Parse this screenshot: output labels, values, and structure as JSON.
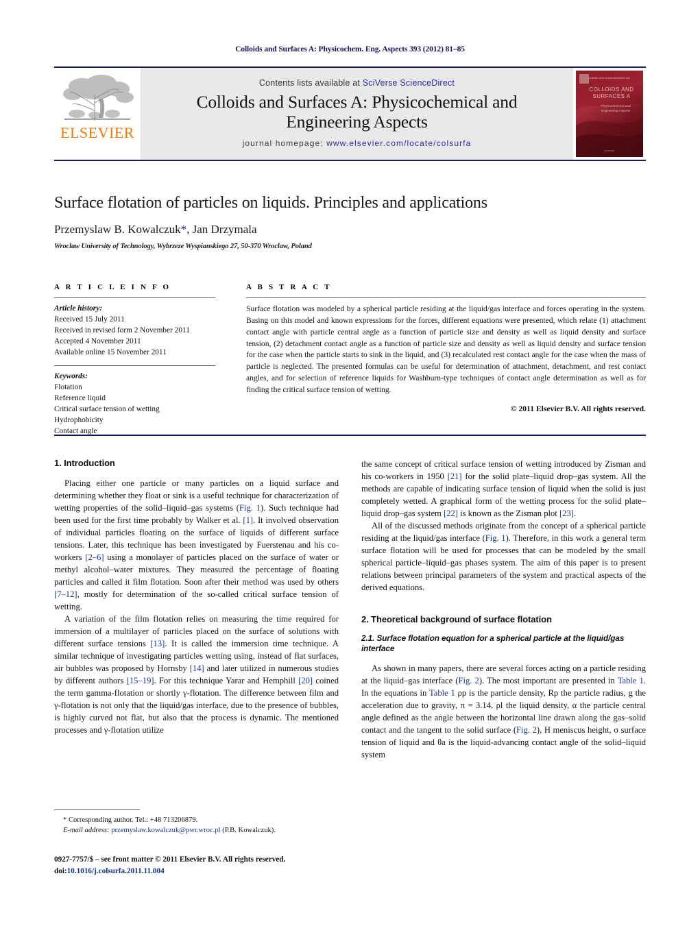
{
  "running_head": "Colloids and Surfaces A: Physicochem. Eng. Aspects 393 (2012) 81–85",
  "masthead": {
    "publisher_logo_text": "ELSEVIER",
    "contents_prefix": "Contents lists available at ",
    "contents_link": "SciVerse ScienceDirect",
    "journal_title_line1": "Colloids and Surfaces A: Physicochemical and",
    "journal_title_line2": "Engineering Aspects",
    "homepage_prefix": "journal homepage: ",
    "homepage_url": "www.elsevier.com/locate/colsurfa",
    "cover_label_line1": "COLLOIDS AND",
    "cover_label_line2": "SURFACES A",
    "cover_sub_line1": "Physicochemical and",
    "cover_sub_line2": "Engineering Aspects"
  },
  "article": {
    "title": "Surface flotation of particles on liquids. Principles and applications",
    "authors_main": "Przemyslaw B. Kowalczuk",
    "authors_star": "*",
    "authors_rest": ", Jan Drzymala",
    "affiliation": "Wroclaw University of Technology, Wybrzeze Wyspianskiego 27, 50-370 Wroclaw, Poland"
  },
  "article_info": {
    "heading": "A R T I C L E    I N F O",
    "history_label": "Article history:",
    "history": [
      "Received 15 July 2011",
      "Received in revised form 2 November 2011",
      "Accepted 4 November 2011",
      "Available online 15 November 2011"
    ],
    "keywords_label": "Keywords:",
    "keywords": [
      "Flotation",
      "Reference liquid",
      "Critical surface tension of wetting",
      "Hydrophobicity",
      "Contact angle"
    ]
  },
  "abstract": {
    "heading": "A B S T R A C T",
    "text": "Surface flotation was modeled by a spherical particle residing at the liquid/gas interface and forces operating in the system. Basing on this model and known expressions for the forces, different equations were presented, which relate (1) attachment contact angle with particle central angle as a function of particle size and density as well as liquid density and surface tension, (2) detachment contact angle as a function of particle size and density as well as liquid density and surface tension for the case when the particle starts to sink in the liquid, and (3) recalculated rest contact angle for the case when the mass of particle is neglected. The presented formulas can be useful for determination of attachment, detachment, and rest contact angles, and for selection of reference liquids for Washburn-type techniques of contact angle determination as well as for finding the critical surface tension of wetting.",
    "copyright": "© 2011 Elsevier B.V. All rights reserved."
  },
  "sections": {
    "introduction_heading": "1.  Introduction",
    "intro_p1_a": "Placing either one particle or many particles on a liquid surface and determining whether they float or sink is a useful technique for characterization of wetting properties of the solid–liquid–gas systems (",
    "intro_p1_fig1": "Fig. 1",
    "intro_p1_b": "). Such technique had been used for the first time probably by Walker et al. ",
    "intro_p1_r1": "[1]",
    "intro_p1_c": ". It involved observation of individual particles floating on the surface of liquids of different surface tensions. Later, this technique has been investigated by Fuerstenau and his co-workers ",
    "intro_p1_r2": "[2–6]",
    "intro_p1_d": " using a monolayer of particles placed on the surface of water or methyl alcohol–water mixtures. They measured the percentage of floating particles and called it film flotation. Soon after their method was used by others ",
    "intro_p1_r3": "[7–12]",
    "intro_p1_e": ", mostly for determination of the so-called critical surface tension of wetting.",
    "intro_p2_a": "A variation of the film flotation relies on measuring the time required for immersion of a multilayer of particles placed on the surface of solutions with different surface tensions ",
    "intro_p2_r1": "[13]",
    "intro_p2_b": ". It is called the immersion time technique. A similar technique of investigating particles wetting using, instead of flat surfaces, air bubbles was proposed by Hornsby ",
    "intro_p2_r2": "[14]",
    "intro_p2_c": " and later utilized in numerous studies by different authors ",
    "intro_p2_r3": "[15–19]",
    "intro_p2_d": ". For this technique Yarar and Hemphill ",
    "intro_p2_r4": "[20]",
    "intro_p2_e": " coined the term gamma-flotation or shortly γ-flotation. The difference between film and γ-flotation is not only that the liquid/gas interface, due to the presence of bubbles, is highly curved not flat, but also that the process is dynamic. The mentioned processes and γ-flotation utilize",
    "right_p1_a": "the same concept of critical surface tension of wetting introduced by Zisman and his co-workers in 1950 ",
    "right_p1_r1": "[21]",
    "right_p1_b": " for the solid plate–liquid drop–gas system. All the methods are capable of indicating surface tension of liquid when the solid is just completely wetted. A graphical form of the wetting process for the solid plate–liquid drop–gas system ",
    "right_p1_r2": "[22]",
    "right_p1_c": " is known as the Zisman plot ",
    "right_p1_r3": "[23]",
    "right_p1_d": ".",
    "right_p2_a": "All of the discussed methods originate from the concept of a spherical particle residing at the liquid/gas interface (",
    "right_p2_fig1": "Fig. 1",
    "right_p2_b": "). Therefore, in this work a general term surface flotation will be used for processes that can be modeled by the small spherical particle–liquid–gas phases system. The aim of this paper is to present relations between principal parameters of the system and practical aspects of the derived equations.",
    "theory_heading": "2.  Theoretical background of surface flotation",
    "subsection_heading": "2.1.  Surface flotation equation for a spherical particle at the liquid/gas interface",
    "theory_p1_a": "As shown in many papers, there are several forces acting on a particle residing at the liquid–gas interface (",
    "theory_p1_fig2": "Fig. 2",
    "theory_p1_b": "). The most important are presented in ",
    "theory_p1_t1": "Table 1",
    "theory_p1_c": ". In the equations in ",
    "theory_p1_t2": "Table 1",
    "theory_p1_d": " ρp is the particle density, Rp the particle radius, g the acceleration due to gravity, π = 3.14, ρl the liquid density, α the particle central angle defined as the angle between the horizontal line drawn along the gas–solid contact and the tangent to the solid surface (",
    "theory_p1_fig2b": "Fig. 2",
    "theory_p1_e": "), H meniscus height, σ surface tension of liquid and θa is the liquid-advancing contact angle of the solid–liquid system"
  },
  "footnote": {
    "corresponding": "* Corresponding author. Tel.: +48 713206879.",
    "email_label": "E-mail address:",
    "email": "przemyslaw.kowalczuk@pwr.wroc.pl",
    "email_suffix": " (P.B. Kowalczuk)."
  },
  "imprint": {
    "line1": "0927-7757/$ – see front matter © 2011 Elsevier B.V. All rights reserved.",
    "doi_prefix": "doi:",
    "doi": "10.1016/j.colsurfa.2011.11.004"
  },
  "colors": {
    "navy": "#16165c",
    "link_blue": "#16348c",
    "elsevier_orange": "#f07c00",
    "masthead_gray": "#e9e9e9",
    "cover_red": "#7d1622"
  }
}
